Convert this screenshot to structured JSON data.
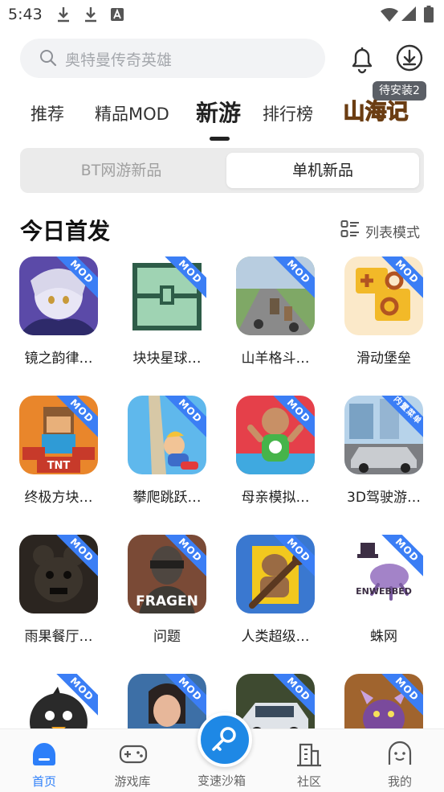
{
  "status": {
    "time": "5:43"
  },
  "search": {
    "placeholder": "奥特曼传奇英雄"
  },
  "header": {
    "pending_badge": "待安装2"
  },
  "tabs": [
    {
      "label": "推荐"
    },
    {
      "label": "精品MOD"
    },
    {
      "label": "新游"
    },
    {
      "label": "排行榜"
    }
  ],
  "logo_tab": {
    "text": "山海记"
  },
  "segment": {
    "left": "BT网游新品",
    "right": "单机新品"
  },
  "section": {
    "title": "今日首发",
    "list_mode": "列表模式"
  },
  "games": [
    {
      "name": "镜之韵律…",
      "tag": "MOD"
    },
    {
      "name": "块块星球…",
      "tag": "MOD"
    },
    {
      "name": "山羊格斗…",
      "tag": "MOD"
    },
    {
      "name": "滑动堡垒",
      "tag": "MOD"
    },
    {
      "name": "终极方块…",
      "tag": "MOD"
    },
    {
      "name": "攀爬跳跃…",
      "tag": "MOD"
    },
    {
      "name": "母亲模拟…",
      "tag": "MOD"
    },
    {
      "name": "3D驾驶游…",
      "tag": "内置菜单"
    },
    {
      "name": "雨果餐厅…",
      "tag": "MOD"
    },
    {
      "name": "问题",
      "tag": "MOD"
    },
    {
      "name": "人类超级…",
      "tag": "MOD"
    },
    {
      "name": "蛛网",
      "tag": "MOD"
    },
    {
      "name": "",
      "tag": "MOD"
    },
    {
      "name": "",
      "tag": "MOD"
    },
    {
      "name": "",
      "tag": "MOD"
    },
    {
      "name": "",
      "tag": "MOD"
    }
  ],
  "tile_text": {
    "fragen": "FRAGEN",
    "enwebbed": "ENWEBBED",
    "tnt": "TNT"
  },
  "bottom_nav": [
    {
      "label": "首页"
    },
    {
      "label": "游戏库"
    },
    {
      "label": "变速沙箱"
    },
    {
      "label": "社区"
    },
    {
      "label": "我的"
    }
  ],
  "colors": {
    "accent": "#2d7ff9",
    "mod_ribbon": "#3b7ef5"
  }
}
